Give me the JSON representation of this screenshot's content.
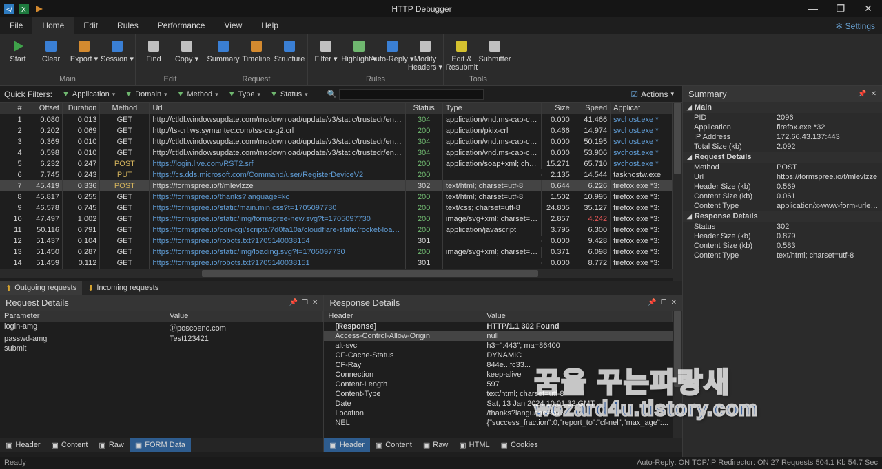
{
  "app": {
    "title": "HTTP Debugger"
  },
  "quicklaunch": [
    "code-icon",
    "excel-icon",
    "script-icon"
  ],
  "winbuttons": {
    "min": "—",
    "max": "❐",
    "close": "✕"
  },
  "menu": {
    "items": [
      "File",
      "Home",
      "Edit",
      "Rules",
      "Performance",
      "View",
      "Help"
    ],
    "active": 1,
    "settings": "Settings"
  },
  "ribbon": [
    {
      "label": "Main",
      "buttons": [
        {
          "name": "start",
          "label": "Start",
          "icon": "play",
          "color": "#3fa24a"
        },
        {
          "name": "clear",
          "label": "Clear",
          "icon": "brush",
          "color": "#3a7fd4"
        },
        {
          "name": "export",
          "label": "Export",
          "icon": "export",
          "color": "#d48a2f",
          "dd": true
        },
        {
          "name": "session",
          "label": "Session",
          "icon": "session",
          "color": "#3a7fd4",
          "dd": true
        }
      ]
    },
    {
      "label": "Edit",
      "buttons": [
        {
          "name": "find",
          "label": "Find",
          "icon": "find",
          "color": "#c0c0c0"
        },
        {
          "name": "copy",
          "label": "Copy",
          "icon": "copy",
          "color": "#c0c0c0",
          "dd": true
        }
      ]
    },
    {
      "label": "Request",
      "buttons": [
        {
          "name": "summary",
          "label": "Summary",
          "icon": "summary",
          "color": "#3a7fd4"
        },
        {
          "name": "timeline",
          "label": "Timeline",
          "icon": "timeline",
          "color": "#d48a2f"
        },
        {
          "name": "structure",
          "label": "Structure",
          "icon": "structure",
          "color": "#3a7fd4"
        }
      ]
    },
    {
      "label": "Rules",
      "buttons": [
        {
          "name": "filter",
          "label": "Filter",
          "icon": "filter",
          "color": "#c0c0c0",
          "dd": true
        },
        {
          "name": "highlight",
          "label": "Highlight",
          "icon": "highlight",
          "color": "#6fb76f",
          "dd": true
        },
        {
          "name": "autoreply",
          "label": "Auto-Reply",
          "icon": "autoreply",
          "color": "#3a7fd4",
          "dd": true
        },
        {
          "name": "modifyheaders",
          "label": "Modify\nHeaders",
          "icon": "modifyheaders",
          "color": "#c0c0c0",
          "dd": true
        }
      ]
    },
    {
      "label": "Tools",
      "buttons": [
        {
          "name": "editresubmit",
          "label": "Edit &\nResubmit",
          "icon": "editresubmit",
          "color": "#d4c12f"
        },
        {
          "name": "submitter",
          "label": "Submitter",
          "icon": "submitter",
          "color": "#c0c0c0"
        }
      ]
    }
  ],
  "quickfilters": {
    "label": "Quick Filters:",
    "items": [
      {
        "name": "application",
        "label": "Application"
      },
      {
        "name": "domain",
        "label": "Domain"
      },
      {
        "name": "method",
        "label": "Method"
      },
      {
        "name": "type",
        "label": "Type"
      },
      {
        "name": "status",
        "label": "Status"
      }
    ],
    "search_placeholder": "",
    "actions": "Actions"
  },
  "grid": {
    "columns": [
      "#",
      "Offset",
      "Duration",
      "Method",
      "Url",
      "Status",
      "Type",
      "Size",
      "Speed",
      "Applicat"
    ],
    "rows": [
      {
        "i": 1,
        "off": "0.080",
        "dur": "0.013",
        "m": "GET",
        "url": "http://ctldl.windowsupdate.com/msdownload/update/v3/static/trustedr/en/disallowedcertstl.c...",
        "s": "304",
        "sc": "green",
        "t": "application/vnd.ms-cab-co...",
        "sz": "0.000",
        "sp": "41.466",
        "app": "svchost.exe *",
        "appc": "link"
      },
      {
        "i": 2,
        "off": "0.202",
        "dur": "0.069",
        "m": "GET",
        "url": "http://ts-crl.ws.symantec.com/tss-ca-g2.crl",
        "s": "200",
        "sc": "green",
        "t": "application/pkix-crl",
        "sz": "0.466",
        "sp": "14.974",
        "app": "svchost.exe *",
        "appc": "link"
      },
      {
        "i": 3,
        "off": "0.369",
        "dur": "0.010",
        "m": "GET",
        "url": "http://ctldl.windowsupdate.com/msdownload/update/v3/static/trustedr/en/authrootstl.cab?1...",
        "s": "304",
        "sc": "green",
        "t": "application/vnd.ms-cab-co...",
        "sz": "0.000",
        "sp": "50.195",
        "app": "svchost.exe *",
        "appc": "link"
      },
      {
        "i": 4,
        "off": "0.598",
        "dur": "0.010",
        "m": "GET",
        "url": "http://ctldl.windowsupdate.com/msdownload/update/v3/static/trustedr/en/disallowedcertstl.c...",
        "s": "304",
        "sc": "green",
        "t": "application/vnd.ms-cab-co...",
        "sz": "0.000",
        "sp": "53.906",
        "app": "svchost.exe *",
        "appc": "link"
      },
      {
        "i": 5,
        "off": "6.232",
        "dur": "0.247",
        "m": "POST",
        "mc": "yellow",
        "url": "https://login.live.com/RST2.srf",
        "urlc": "link",
        "s": "200",
        "sc": "green",
        "t": "application/soap+xml; char...",
        "sz": "15.271",
        "sp": "65.710",
        "app": "svchost.exe *",
        "appc": "link"
      },
      {
        "i": 6,
        "off": "7.745",
        "dur": "0.243",
        "m": "PUT",
        "mc": "yellow",
        "url": "https://cs.dds.microsoft.com/Command/user/RegisterDeviceV2",
        "urlc": "link",
        "s": "200",
        "sc": "green",
        "t": "",
        "sz": "2.135",
        "sp": "14.544",
        "app": "taskhostw.exe"
      },
      {
        "i": 7,
        "sel": true,
        "off": "45.419",
        "dur": "0.336",
        "m": "POST",
        "mc": "yellow",
        "url": "https://formspree.io/f/mlevlzze",
        "s": "302",
        "t": "text/html; charset=utf-8",
        "sz": "0.644",
        "sp": "6.226",
        "app": "firefox.exe *3:"
      },
      {
        "i": 8,
        "off": "45.817",
        "dur": "0.255",
        "m": "GET",
        "url": "https://formspree.io/thanks?language=ko",
        "urlc": "link",
        "s": "200",
        "sc": "green",
        "t": "text/html; charset=utf-8",
        "sz": "1.502",
        "sp": "10.995",
        "app": "firefox.exe *3:"
      },
      {
        "i": 9,
        "off": "46.578",
        "dur": "0.745",
        "m": "GET",
        "url": "https://formspree.io/static/main.min.css?t=1705097730",
        "urlc": "link",
        "s": "200",
        "sc": "green",
        "t": "text/css; charset=utf-8",
        "sz": "24.805",
        "sp": "35.127",
        "app": "firefox.exe *3:"
      },
      {
        "i": 10,
        "off": "47.497",
        "dur": "1.002",
        "m": "GET",
        "url": "https://formspree.io/static/img/formspree-new.svg?t=1705097730",
        "urlc": "link",
        "s": "200",
        "sc": "green",
        "t": "image/svg+xml; charset=u...",
        "sz": "2.857",
        "sp": "4.242",
        "spc": "red",
        "app": "firefox.exe *3:"
      },
      {
        "i": 11,
        "off": "50.116",
        "dur": "0.791",
        "m": "GET",
        "url": "https://formspree.io/cdn-cgi/scripts/7d0fa10a/cloudflare-static/rocket-loader.min.js",
        "urlc": "link",
        "s": "200",
        "sc": "green",
        "t": "application/javascript",
        "sz": "3.795",
        "sp": "6.300",
        "app": "firefox.exe *3:"
      },
      {
        "i": 12,
        "off": "51.437",
        "dur": "0.104",
        "m": "GET",
        "url": "https://formspree.io/robots.txt?1705140038154",
        "urlc": "link",
        "s": "301",
        "t": "",
        "sz": "0.000",
        "sp": "9.428",
        "app": "firefox.exe *3:"
      },
      {
        "i": 13,
        "off": "51.450",
        "dur": "0.287",
        "m": "GET",
        "url": "https://formspree.io/static/img/loading.svg?t=1705097730",
        "urlc": "link",
        "s": "200",
        "sc": "green",
        "t": "image/svg+xml; charset=u...",
        "sz": "0.371",
        "sp": "6.098",
        "app": "firefox.exe *3:"
      },
      {
        "i": 14,
        "off": "51.459",
        "dur": "0.112",
        "m": "GET",
        "url": "https://formspree.io/robots.txt?1705140038151",
        "urlc": "link",
        "s": "301",
        "t": "",
        "sz": "0.000",
        "sp": "8.772",
        "app": "firefox.exe *3:"
      }
    ]
  },
  "tabs": {
    "outgoing": "Outgoing requests",
    "incoming": "Incoming requests"
  },
  "request_details": {
    "title": "Request Details",
    "columns": [
      "Parameter",
      "Value"
    ],
    "rows": [
      {
        "k": "login-amg",
        "v": "ⓟposcoenc.com"
      },
      {
        "k": "passwd-amg",
        "v": "Test123421"
      },
      {
        "k": "submit",
        "v": ""
      }
    ],
    "btabs": [
      {
        "name": "header",
        "label": "Header"
      },
      {
        "name": "content",
        "label": "Content"
      },
      {
        "name": "raw",
        "label": "Raw"
      },
      {
        "name": "formdata",
        "label": "FORM Data",
        "active": true
      }
    ]
  },
  "response_details": {
    "title": "Response Details",
    "columns": [
      "Header",
      "Value"
    ],
    "rows": [
      {
        "k": "[Response]",
        "v": "HTTP/1.1 302 Found",
        "bold": true
      },
      {
        "k": "Access-Control-Allow-Origin",
        "v": "null",
        "sel": true
      },
      {
        "k": "alt-svc",
        "v": "h3=\":443\"; ma=86400"
      },
      {
        "k": "CF-Cache-Status",
        "v": "DYNAMIC"
      },
      {
        "k": "CF-Ray",
        "v": "844e...fc33..."
      },
      {
        "k": "Connection",
        "v": "keep-alive"
      },
      {
        "k": "Content-Length",
        "v": "597"
      },
      {
        "k": "Content-Type",
        "v": "text/html; charset=utf-8"
      },
      {
        "k": "Date",
        "v": "Sat, 13 Jan 2024 10:01:32 GMT"
      },
      {
        "k": "Location",
        "v": "/thanks?language=ko"
      },
      {
        "k": "NEL",
        "v": "{\"success_fraction\":0,\"report_to\":\"cf-nel\",\"max_age\":..."
      }
    ],
    "btabs": [
      {
        "name": "header",
        "label": "Header",
        "active": true
      },
      {
        "name": "content",
        "label": "Content"
      },
      {
        "name": "raw",
        "label": "Raw"
      },
      {
        "name": "html",
        "label": "HTML"
      },
      {
        "name": "cookies",
        "label": "Cookies"
      }
    ]
  },
  "summary": {
    "title": "Summary",
    "sections": [
      {
        "title": "Main",
        "rows": [
          {
            "k": "PID",
            "v": "2096"
          },
          {
            "k": "Application",
            "v": "firefox.exe *32"
          },
          {
            "k": "IP Address",
            "v": "172.66.43.137:443"
          },
          {
            "k": "Total Size (kb)",
            "v": "2.092"
          }
        ]
      },
      {
        "title": "Request Details",
        "rows": [
          {
            "k": "Method",
            "v": "POST"
          },
          {
            "k": "Url",
            "v": "https://formspree.io/f/mlevlzze"
          },
          {
            "k": "Header Size (kb)",
            "v": "0.569"
          },
          {
            "k": "Content Size (kb)",
            "v": "0.061"
          },
          {
            "k": "Content Type",
            "v": "application/x-www-form-urlenco"
          }
        ]
      },
      {
        "title": "Response Details",
        "rows": [
          {
            "k": "Status",
            "v": "302"
          },
          {
            "k": "Header Size (kb)",
            "v": "0.879"
          },
          {
            "k": "Content Size (kb)",
            "v": "0.583"
          },
          {
            "k": "Content Type",
            "v": "text/html; charset=utf-8"
          }
        ]
      }
    ]
  },
  "statusbar": {
    "left": "Ready",
    "right": "Auto-Reply: ON   TCP/IP Redirector: ON   27 Requests   504.1 Kb   54.7 Sec"
  },
  "watermark": {
    "l1": "꿈을 꾸는파랑새",
    "l2": "wezard4u.tistory.com"
  }
}
